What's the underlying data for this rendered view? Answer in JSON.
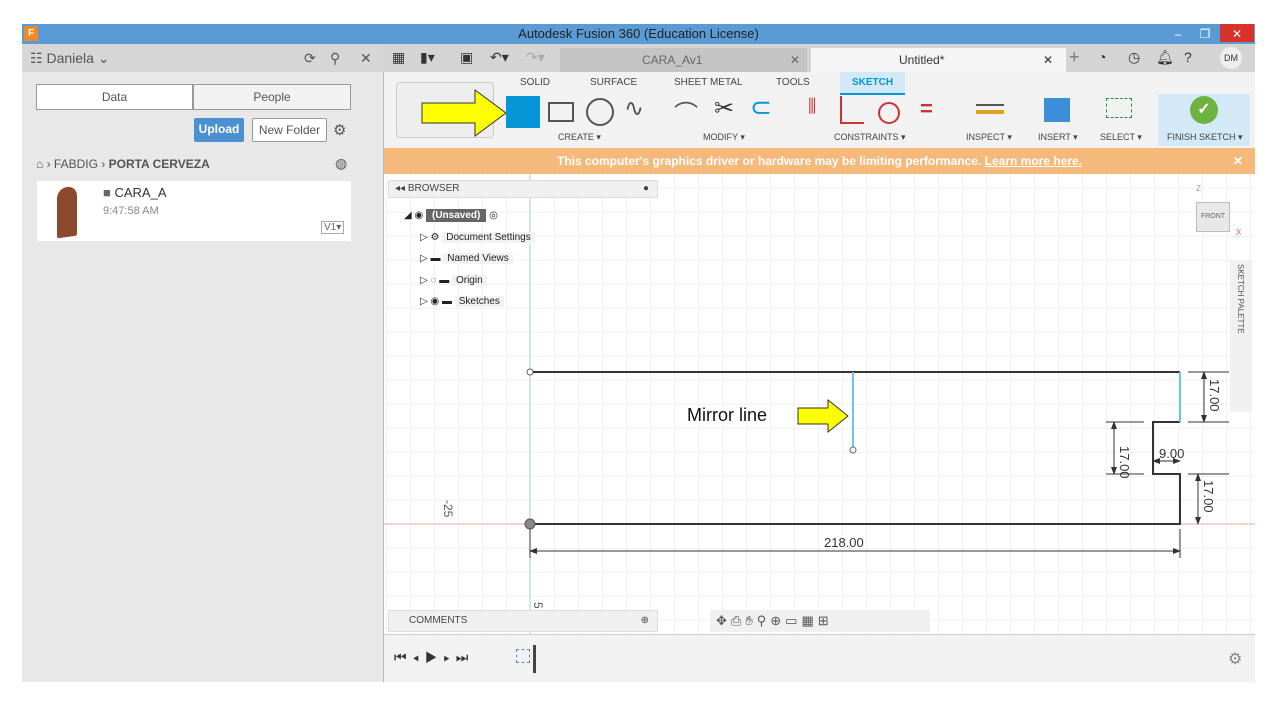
{
  "window": {
    "title": "Autodesk Fusion 360 (Education License)",
    "minimize": "–",
    "restore": "❐",
    "close": "✕",
    "app_icon": "F"
  },
  "left_panel": {
    "user": "Daniela",
    "tabs": [
      "Data",
      "People"
    ],
    "upload": "Upload",
    "new_folder": "New Folder",
    "breadcrumb": [
      "FABDIG",
      "PORTA CERVEZA"
    ],
    "file": {
      "name": "CARA_A",
      "time": "9:47:58 AM",
      "version": "V1▾"
    }
  },
  "doc_tabs": [
    {
      "label": "CARA_Av1"
    },
    {
      "label": "Untitled*"
    }
  ],
  "user_initials": "DM",
  "ribbon": {
    "tabs": [
      "SOLID",
      "SURFACE",
      "SHEET METAL",
      "TOOLS",
      "SKETCH"
    ],
    "active_tab": "SKETCH",
    "groups": [
      "CREATE ▾",
      "MODIFY ▾",
      "CONSTRAINTS ▾",
      "INSPECT ▾",
      "INSERT ▾",
      "SELECT ▾",
      "FINISH SKETCH ▾"
    ]
  },
  "warning": {
    "text": "This computer's graphics driver or hardware may be limiting performance.",
    "link": "Learn more here.",
    "close": "✕"
  },
  "browser": {
    "title": "BROWSER",
    "items": [
      "(Unsaved)",
      "Document Settings",
      "Named Views",
      "Origin",
      "Sketches"
    ]
  },
  "comments": "COMMENTS",
  "sketch_palette": "SKETCH PALETTE",
  "viewcube": {
    "label": "FRONT",
    "z": "Z",
    "x": "X"
  },
  "annotation": {
    "text": "Mirror line"
  },
  "dimensions": {
    "width": "218.00",
    "top": "17.00",
    "middle": "17.00",
    "notch": "9.00",
    "bottom": "17.00",
    "axis_neg": "-25",
    "axis_pos": "5"
  },
  "colors": {
    "accent": "#0696d7",
    "warning": "#f5b97b",
    "arrow": "#ffff00",
    "finish": "#6cb33f"
  }
}
